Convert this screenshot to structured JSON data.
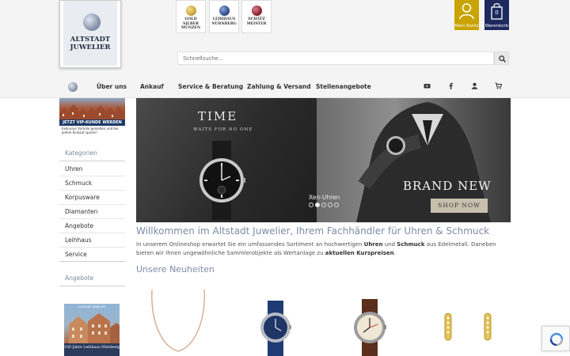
{
  "logo": {
    "line1": "ALTSTADT",
    "line2": "JUWELIER"
  },
  "badges": [
    {
      "text": "GOLD SILBER\nMÜNZEN",
      "color": "#c9a23a"
    },
    {
      "text": "LEIHHAUS\nNÜRNBERG",
      "color": "#2c4a8a"
    },
    {
      "text": "SCHÄTZ\nMEISTER",
      "color": "#8a1f2c"
    }
  ],
  "account": {
    "label": "Mein Konto",
    "color": "#c9a400"
  },
  "cart": {
    "label": "Warenkorb",
    "count": "0",
    "color": "#1e2a5e"
  },
  "search": {
    "placeholder": "Schnellsuche..."
  },
  "nav": {
    "items": [
      "Über uns",
      "Ankauf",
      "Service & Beratung",
      "Zahlung & Versand",
      "Stellenangebote"
    ],
    "icons": [
      "youtube-icon",
      "facebook-icon",
      "user-icon",
      "cart-icon"
    ]
  },
  "vip": {
    "banner": "JETZT VIP-KUNDE WERDEN",
    "text": "Exklusive Vorteile genießen und bei jedem Einkauf sparen!"
  },
  "sidebar": {
    "categories_heading": "Kategorien",
    "items": [
      "Uhren",
      "Schmuck",
      "Korpusware",
      "Diamanten",
      "Angebote",
      "Leihhaus",
      "Service"
    ],
    "offers_heading": "Angebote"
  },
  "book": {
    "title": "ALTSTADT JUWELIER",
    "footer": "100 Jahre  Leihhaus Nürnberg"
  },
  "slider": {
    "left_title": "TIME",
    "left_subtitle": "WAITS FOR NO ONE",
    "right_title": "BRAND NEW",
    "button": "SHOP NOW",
    "caption": "Xen-Uhren",
    "slide_count": 5,
    "active_index": 1
  },
  "welcome": {
    "title": "Willkommen im Altstadt Juwelier, Ihrem Fachhändler für Uhren & Schmuck",
    "text_1": "In unserem Onlineshop erwartet Sie ein umfassendes Sortiment an hochwertigen ",
    "strong_1": "Uhren",
    "text_2": " und ",
    "strong_2": "Schmuck",
    "text_3": " aus Edelmetall. Daneben bieten wir Ihnen ungewöhnliche Sammlerobjekte als Wertanlage zu ",
    "strong_3": "aktuellen Kurspreisen",
    "text_4": "."
  },
  "new_products": {
    "heading": "Unsere Neuheiten"
  },
  "colors": {
    "accent": "#7d8ba3",
    "gold": "#c9a400",
    "navy": "#1e2a5e"
  }
}
